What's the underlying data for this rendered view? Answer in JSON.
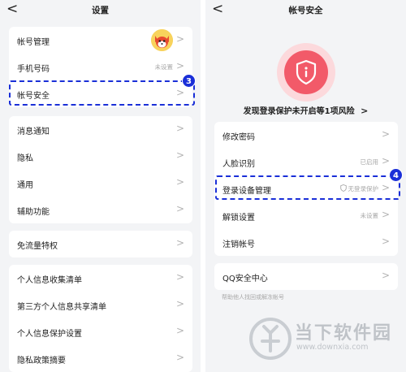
{
  "left": {
    "title": "设置",
    "back_icon": "chevron-left-icon",
    "groups": [
      [
        {
          "label": "帐号管理",
          "status": ""
        },
        {
          "label": "手机号码",
          "status": "未设置"
        },
        {
          "label": "帐号安全",
          "status": ""
        }
      ],
      [
        {
          "label": "消息通知",
          "status": ""
        },
        {
          "label": "隐私",
          "status": ""
        },
        {
          "label": "通用",
          "status": ""
        },
        {
          "label": "辅助功能",
          "status": ""
        }
      ],
      [
        {
          "label": "免流量特权",
          "status": ""
        }
      ],
      [
        {
          "label": "个人信息收集清单",
          "status": ""
        },
        {
          "label": "第三方个人信息共享清单",
          "status": ""
        },
        {
          "label": "个人信息保护设置",
          "status": ""
        },
        {
          "label": "隐私政策摘要",
          "status": ""
        }
      ]
    ],
    "step_badge": "3"
  },
  "right": {
    "title": "帐号安全",
    "back_icon": "chevron-left-icon",
    "risk_text": "发现登录保护未开启等1项风险",
    "risk_chevron": ">",
    "shield_icon": "shield-info-icon",
    "items": [
      {
        "label": "修改密码",
        "status": ""
      },
      {
        "label": "人脸识别",
        "status": "已启用"
      },
      {
        "label": "登录设备管理",
        "status": "无登录保护"
      },
      {
        "label": "解锁设置",
        "status": "未设置"
      },
      {
        "label": "注销帐号",
        "status": ""
      }
    ],
    "qq_center": {
      "label": "QQ安全中心"
    },
    "hint": "帮助他人找回或解冻帐号",
    "step_badge": "4"
  },
  "chevron": ">",
  "back_glyph": "<",
  "watermark": {
    "main": "当下软件园",
    "url": "www.downxia.com"
  },
  "colors": {
    "accent_blue": "#1a2fd8",
    "danger_red": "#f25a69",
    "background": "#f3f4f6"
  }
}
